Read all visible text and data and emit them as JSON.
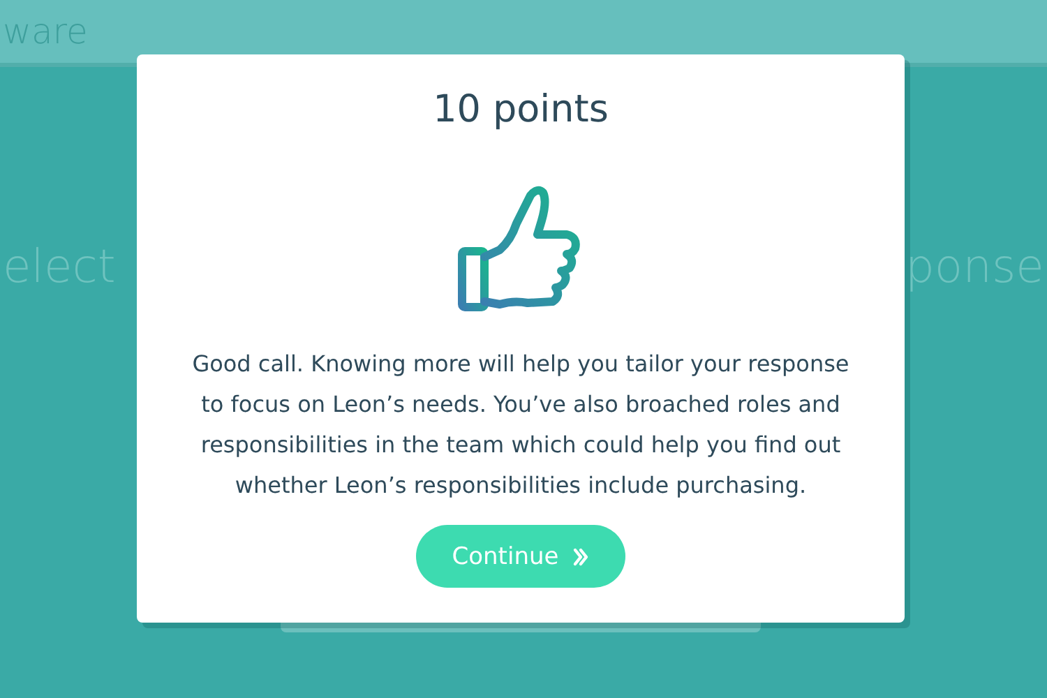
{
  "header": {
    "title": "ware"
  },
  "background": {
    "left_text": "elect",
    "right_text": "ponse"
  },
  "dialog": {
    "title": "10 points",
    "message": "Good call. Knowing more will help you tailor your response to focus on Leon’s needs. You’ve also broached roles and responsibilities in the team which could help you find out whether Leon’s responsibilities include purchasing.",
    "button": {
      "label": "Continue"
    }
  }
}
